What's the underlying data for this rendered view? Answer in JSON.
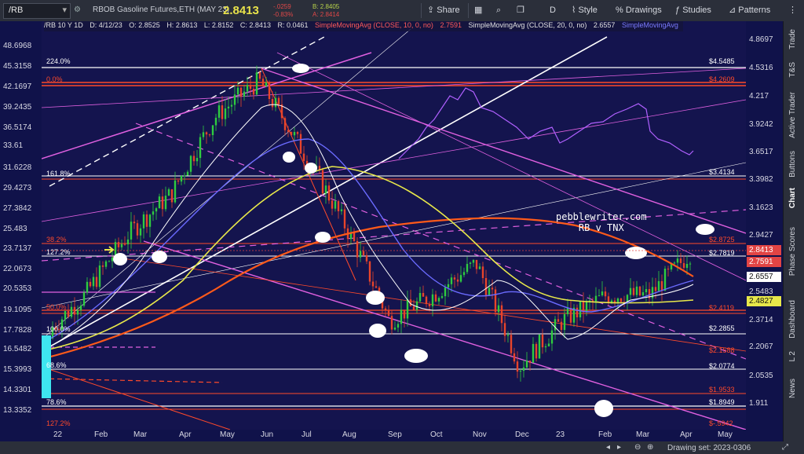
{
  "toolbar": {
    "symbol": "/RB",
    "description": "RBOB Gasoline Futures,ETH (MAY 23)",
    "last_price": "2.8413",
    "change_abs": "-.0259",
    "change_pct": "-0.83%",
    "bid": "B: 2.8405",
    "ask": "A: 2.8414",
    "share": "Share",
    "interval": "D",
    "style": "Style",
    "drawings": "Drawings",
    "studies": "Studies",
    "patterns": "Patterns"
  },
  "legend": {
    "symbol_line": "/RB 10 Y 1D",
    "date": "D: 4/12/23",
    "open": "O: 2.8525",
    "high": "H: 2.8613",
    "low": "L: 2.8152",
    "close": "C: 2.8413",
    "range": "R: 0.0461",
    "sma1": "SimpleMovingAvg (CLOSE, 10, 0, no)",
    "sma1_val": "2.7591",
    "sma2": "SimpleMovingAvg (CLOSE, 20, 0, no)",
    "sma2_val": "2.6557",
    "sma3": "SimpleMovingAvg"
  },
  "watermark": {
    "line1": "pebblewriter.com",
    "line2": "RB v TNX"
  },
  "left_axis_ticks": [
    "48.6968",
    "45.3158",
    "42.1697",
    "39.2435",
    "36.5174",
    "33.61",
    "31.6228",
    "29.4273",
    "27.3842",
    "25.483",
    "23.7137",
    "22.0673",
    "20.5353",
    "19.1095",
    "17.7828",
    "16.5482",
    "15.3993",
    "14.3301",
    "13.3352"
  ],
  "right_axis_ticks": [
    "4.8697",
    "4.5316",
    "4.217",
    "3.9242",
    "3.6517",
    "3.3982",
    "3.1623",
    "2.9427",
    "2.5483",
    "2.3714",
    "2.2067",
    "2.0535",
    "1.911"
  ],
  "price_tags": [
    {
      "label": "2.8413",
      "bg": "#e24444",
      "fg": "#ffffff"
    },
    {
      "label": "2.7591",
      "bg": "#e24444",
      "fg": "#ffffff"
    },
    {
      "label": "2.6557",
      "bg": "#ffffff",
      "fg": "#111111"
    },
    {
      "label": "2.4827",
      "bg": "#e8e84a",
      "fg": "#111111"
    }
  ],
  "fib_labels_left": [
    "224.0%",
    "0.0%",
    "161.8%",
    "38.2%",
    "127.2%",
    "50.0%",
    "100.0%",
    "68.6%",
    "78.6%",
    "127.2%"
  ],
  "fib_labels_right": [
    "$4.5485",
    "$4.2609",
    "$3.4134",
    "$2.8725",
    "$2.7819",
    "$2.4119",
    "$2.2855",
    "$2.1588",
    "$2.0774",
    "$1.9533",
    "$1.8949",
    "$-.5942"
  ],
  "x_axis_labels": [
    "22",
    "Feb",
    "Mar",
    "Apr",
    "May",
    "Jun",
    "Jul",
    "Aug",
    "Sep",
    "Oct",
    "Nov",
    "Dec",
    "23",
    "Feb",
    "Mar",
    "Apr",
    "May"
  ],
  "side_tabs": [
    "Trade",
    "T&S",
    "Active Trader",
    "Buttons",
    "Chart",
    "Phase Scores",
    "Dashboard",
    "L 2",
    "News"
  ],
  "bottom_bar": {
    "drawing_set": "Drawing set: 2023-0306"
  },
  "chart_data": {
    "type": "line",
    "title": "RBOB Gasoline Futures,ETH (MAY 23)",
    "x": [
      "22",
      "Feb",
      "Mar",
      "Apr",
      "May",
      "Jun",
      "Jul",
      "Aug",
      "Sep",
      "Oct",
      "Nov",
      "Dec",
      "23",
      "Feb",
      "Mar",
      "Apr"
    ],
    "series": [
      {
        "name": "/RB",
        "values": [
          2.3,
          2.55,
          2.95,
          3.25,
          3.9,
          4.25,
          3.6,
          3.0,
          2.4,
          2.55,
          2.75,
          2.15,
          2.4,
          2.55,
          2.55,
          2.84
        ]
      },
      {
        "name": "SimpleMovingAvg (CLOSE, 10, 0, no)",
        "values": [
          2.28,
          2.5,
          2.85,
          3.2,
          3.8,
          4.15,
          3.7,
          3.05,
          2.5,
          2.5,
          2.7,
          2.25,
          2.35,
          2.5,
          2.6,
          2.7591
        ]
      },
      {
        "name": "SimpleMovingAvg (CLOSE, 20, 0, no)",
        "values": [
          2.25,
          2.45,
          2.75,
          3.1,
          3.6,
          4.0,
          3.8,
          3.15,
          2.6,
          2.45,
          2.65,
          2.35,
          2.3,
          2.45,
          2.55,
          2.6557
        ]
      }
    ],
    "ylim": [
      1.85,
      4.9
    ],
    "price_scale": "log"
  }
}
